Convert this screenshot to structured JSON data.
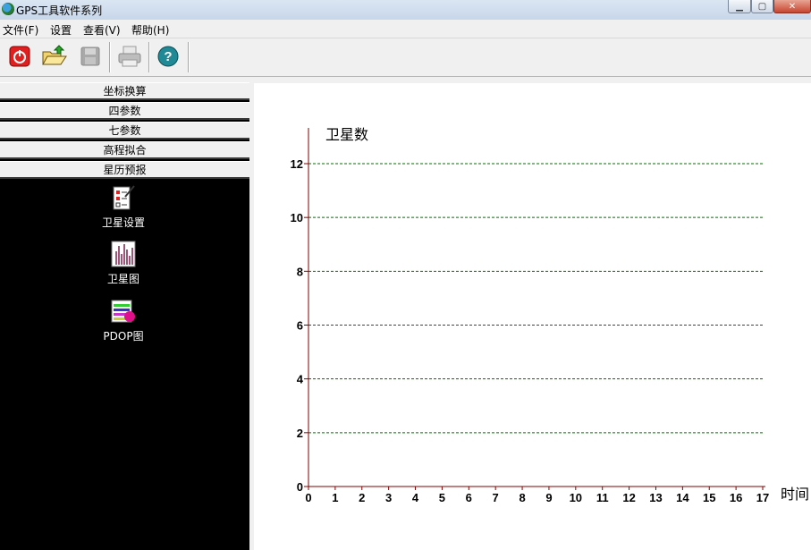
{
  "window": {
    "title": "GPS工具软件系列"
  },
  "menu": [
    "文件(F)",
    "设置",
    "查看(V)",
    "帮助(H)"
  ],
  "toolbar": {
    "buttons": [
      {
        "name": "power",
        "icon": "power-icon",
        "enabled": true
      },
      {
        "name": "open",
        "icon": "folder-open-icon",
        "enabled": true
      },
      {
        "name": "save",
        "icon": "save-icon",
        "enabled": false
      },
      {
        "name": "print",
        "icon": "printer-icon",
        "enabled": false
      },
      {
        "name": "help",
        "icon": "help-icon",
        "enabled": true
      }
    ]
  },
  "sidebar": {
    "categories": [
      "坐标换算",
      "四参数",
      "七参数",
      "高程拟合",
      "星历预报"
    ],
    "tools": [
      "卫星设置",
      "卫星图",
      "PDOP图"
    ]
  },
  "colors": {
    "axis": "#800000",
    "grid": "#007000",
    "panel": "#000000"
  },
  "chart_data": {
    "type": "bar",
    "ylabel": "卫星数",
    "xlabel": "时间",
    "x_ticks": [
      "0",
      "1",
      "2",
      "3",
      "4",
      "5",
      "6",
      "7",
      "8",
      "9",
      "10",
      "11",
      "12",
      "13",
      "14",
      "15",
      "16",
      "17"
    ],
    "y_ticks": [
      "0",
      "2",
      "4",
      "6",
      "8",
      "10",
      "12"
    ],
    "xlim": [
      0,
      17
    ],
    "ylim": [
      0,
      12
    ],
    "grid": true,
    "series": []
  }
}
